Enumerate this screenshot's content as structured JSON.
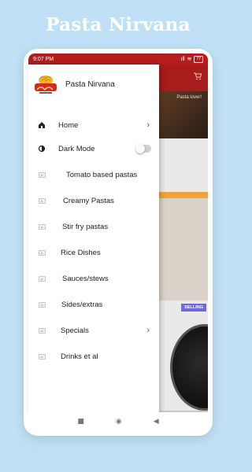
{
  "promo": {
    "title": "Pasta Nirvana"
  },
  "statusbar": {
    "time": "9:07 PM",
    "signal": "ıll",
    "wifi": "≋",
    "battery": "77"
  },
  "app": {
    "banner_text": "Pasta lover!",
    "badge": "SELLING"
  },
  "drawer": {
    "title": "Pasta Nirvana",
    "items": [
      {
        "label": "Home",
        "icon": "home-icon"
      },
      {
        "label": "Dark Mode",
        "icon": "dark-mode-icon"
      },
      {
        "label": "Tomato based pastas",
        "icon": "image-placeholder-icon"
      },
      {
        "label": "Creamy Pastas",
        "icon": "image-placeholder-icon"
      },
      {
        "label": "Stir fry pastas",
        "icon": "image-placeholder-icon"
      },
      {
        "label": "Rice Dishes",
        "icon": "image-placeholder-icon"
      },
      {
        "label": "Sauces/stews",
        "icon": "image-placeholder-icon"
      },
      {
        "label": "Sides/extras",
        "icon": "image-placeholder-icon"
      },
      {
        "label": "Specials",
        "icon": "image-placeholder-icon"
      },
      {
        "label": "Drinks et al",
        "icon": "image-placeholder-icon"
      }
    ]
  },
  "navbar": {
    "square": "■",
    "circle": "◉",
    "back": "◀"
  },
  "colors": {
    "accent": "#b71c1c",
    "background": "#bfe0f5",
    "badge": "#6f68d8"
  }
}
